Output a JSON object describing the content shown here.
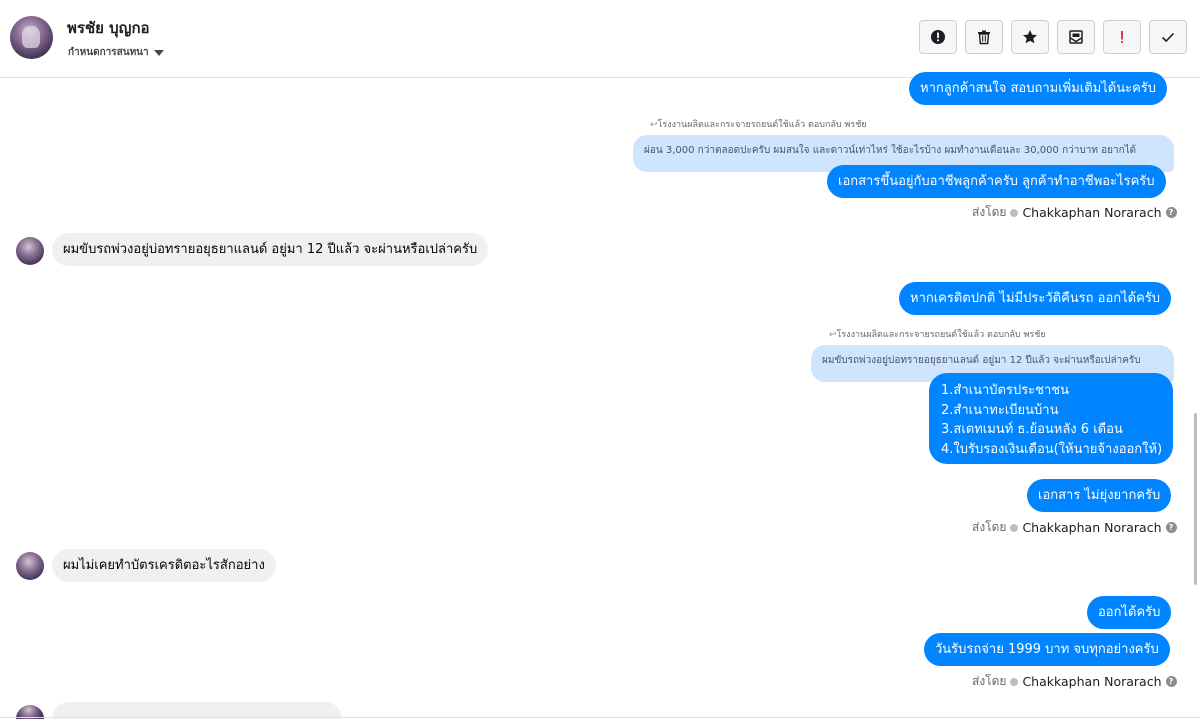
{
  "header": {
    "contact_name": "พรชัย บุญกอ",
    "assign_label": "กำหนดการสนทนา",
    "toolbar": [
      {
        "name": "spam-button",
        "icon": "alert-circle-icon"
      },
      {
        "name": "delete-button",
        "icon": "trash-icon"
      },
      {
        "name": "star-button",
        "icon": "star-icon"
      },
      {
        "name": "mark-unread-button",
        "icon": "envelope-icon"
      },
      {
        "name": "important-button",
        "icon": "exclamation-icon"
      },
      {
        "name": "done-button",
        "icon": "check-icon"
      }
    ]
  },
  "messages": {
    "m1": "หากลูกค้าสนใจ สอบถามเพิ่มเติมได้นะครับ",
    "reply1_meta": "โรงงานผลิตและกระจายรถยนต์ใช้แล้ว ตอบกลับ พรชัย",
    "quote1": "ผ่อน 3,000 กว่าตลอดปะครับ ผมสนใจ และดาวน์เท่าไหร่ ใช้อะไรบ้าง ผมทำงานเดือนละ 30,000 กว่าบาท อยากได้",
    "m2": "เอกสารขึ้นอยู่กับอาชีพลูกค้าครับ ลูกค้าทำอาชีพอะไรครับ",
    "in1": "ผมขับรถพ่วงอยู่บ่อทรายอยุธยาแลนด์ อยู่มา 12 ปีแล้ว จะผ่านหรือเปล่าครับ",
    "m3": "หากเครดิตปกติ ไม่มีประวัติคืนรถ ออกได้ครับ",
    "reply2_meta": "โรงงานผลิตและกระจายรถยนต์ใช้แล้ว ตอบกลับ พรชัย",
    "quote2": "ผมขับรถพ่วงอยู่บ่อทรายอยุธยาแลนด์ อยู่มา 12 ปีแล้ว จะผ่านหรือเปล่าครับ",
    "list_lines": [
      "1.สำเนาบัตรประชาชน",
      "2.สำเนาทะเบียนบ้าน",
      "3.สเตทเมนท์ ธ.ย้อนหลัง 6 เดือน",
      "4.ใบรับรองเงินเดือน(ให้นายจ้างออกให้)"
    ],
    "m4": "เอกสาร ไม่ยุ่งยากครับ",
    "in2": "ผมไม่เคยทำบัตรเครดิตอะไรสักอย่าง",
    "m5": "ออกได้ครับ",
    "m6": "วันรับรถจ่าย 1999 บาท จบทุกอย่างครับ"
  },
  "sent_by": {
    "prefix": "ส่งโดย",
    "agent": "Chakkaphan Norarach"
  }
}
